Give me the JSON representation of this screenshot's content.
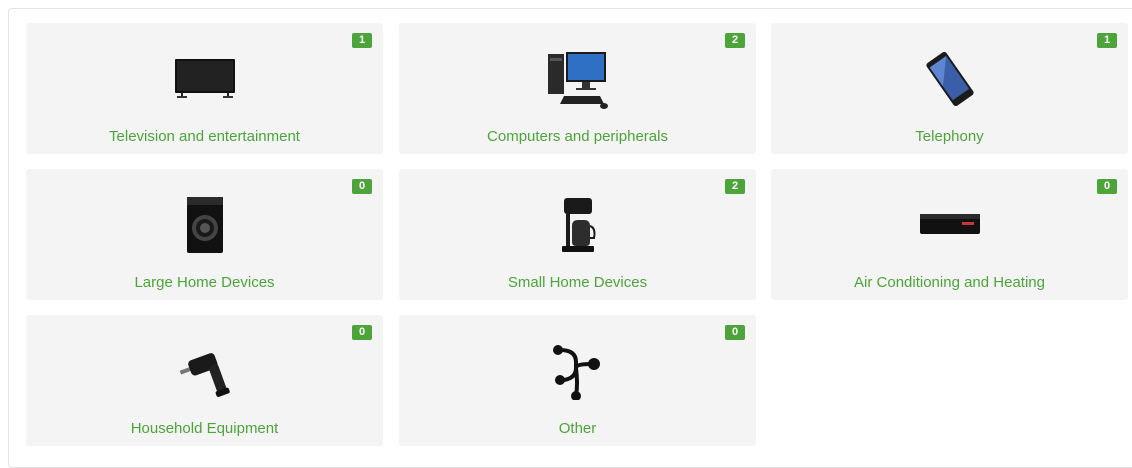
{
  "categories": [
    {
      "label": "Television and entertainment",
      "count": "1",
      "icon": "television-icon"
    },
    {
      "label": "Computers and peripherals",
      "count": "2",
      "icon": "computer-icon"
    },
    {
      "label": "Telephony",
      "count": "1",
      "icon": "smartphone-icon"
    },
    {
      "label": "Large Home Devices",
      "count": "0",
      "icon": "washing-machine-icon"
    },
    {
      "label": "Small Home Devices",
      "count": "2",
      "icon": "coffee-maker-icon"
    },
    {
      "label": "Air Conditioning and Heating",
      "count": "0",
      "icon": "air-conditioner-icon"
    },
    {
      "label": "Household Equipment",
      "count": "0",
      "icon": "drill-icon"
    },
    {
      "label": "Other",
      "count": "0",
      "icon": "branches-icon"
    }
  ],
  "colors": {
    "accent": "#4ca43a",
    "card_bg": "#f4f4f4"
  }
}
